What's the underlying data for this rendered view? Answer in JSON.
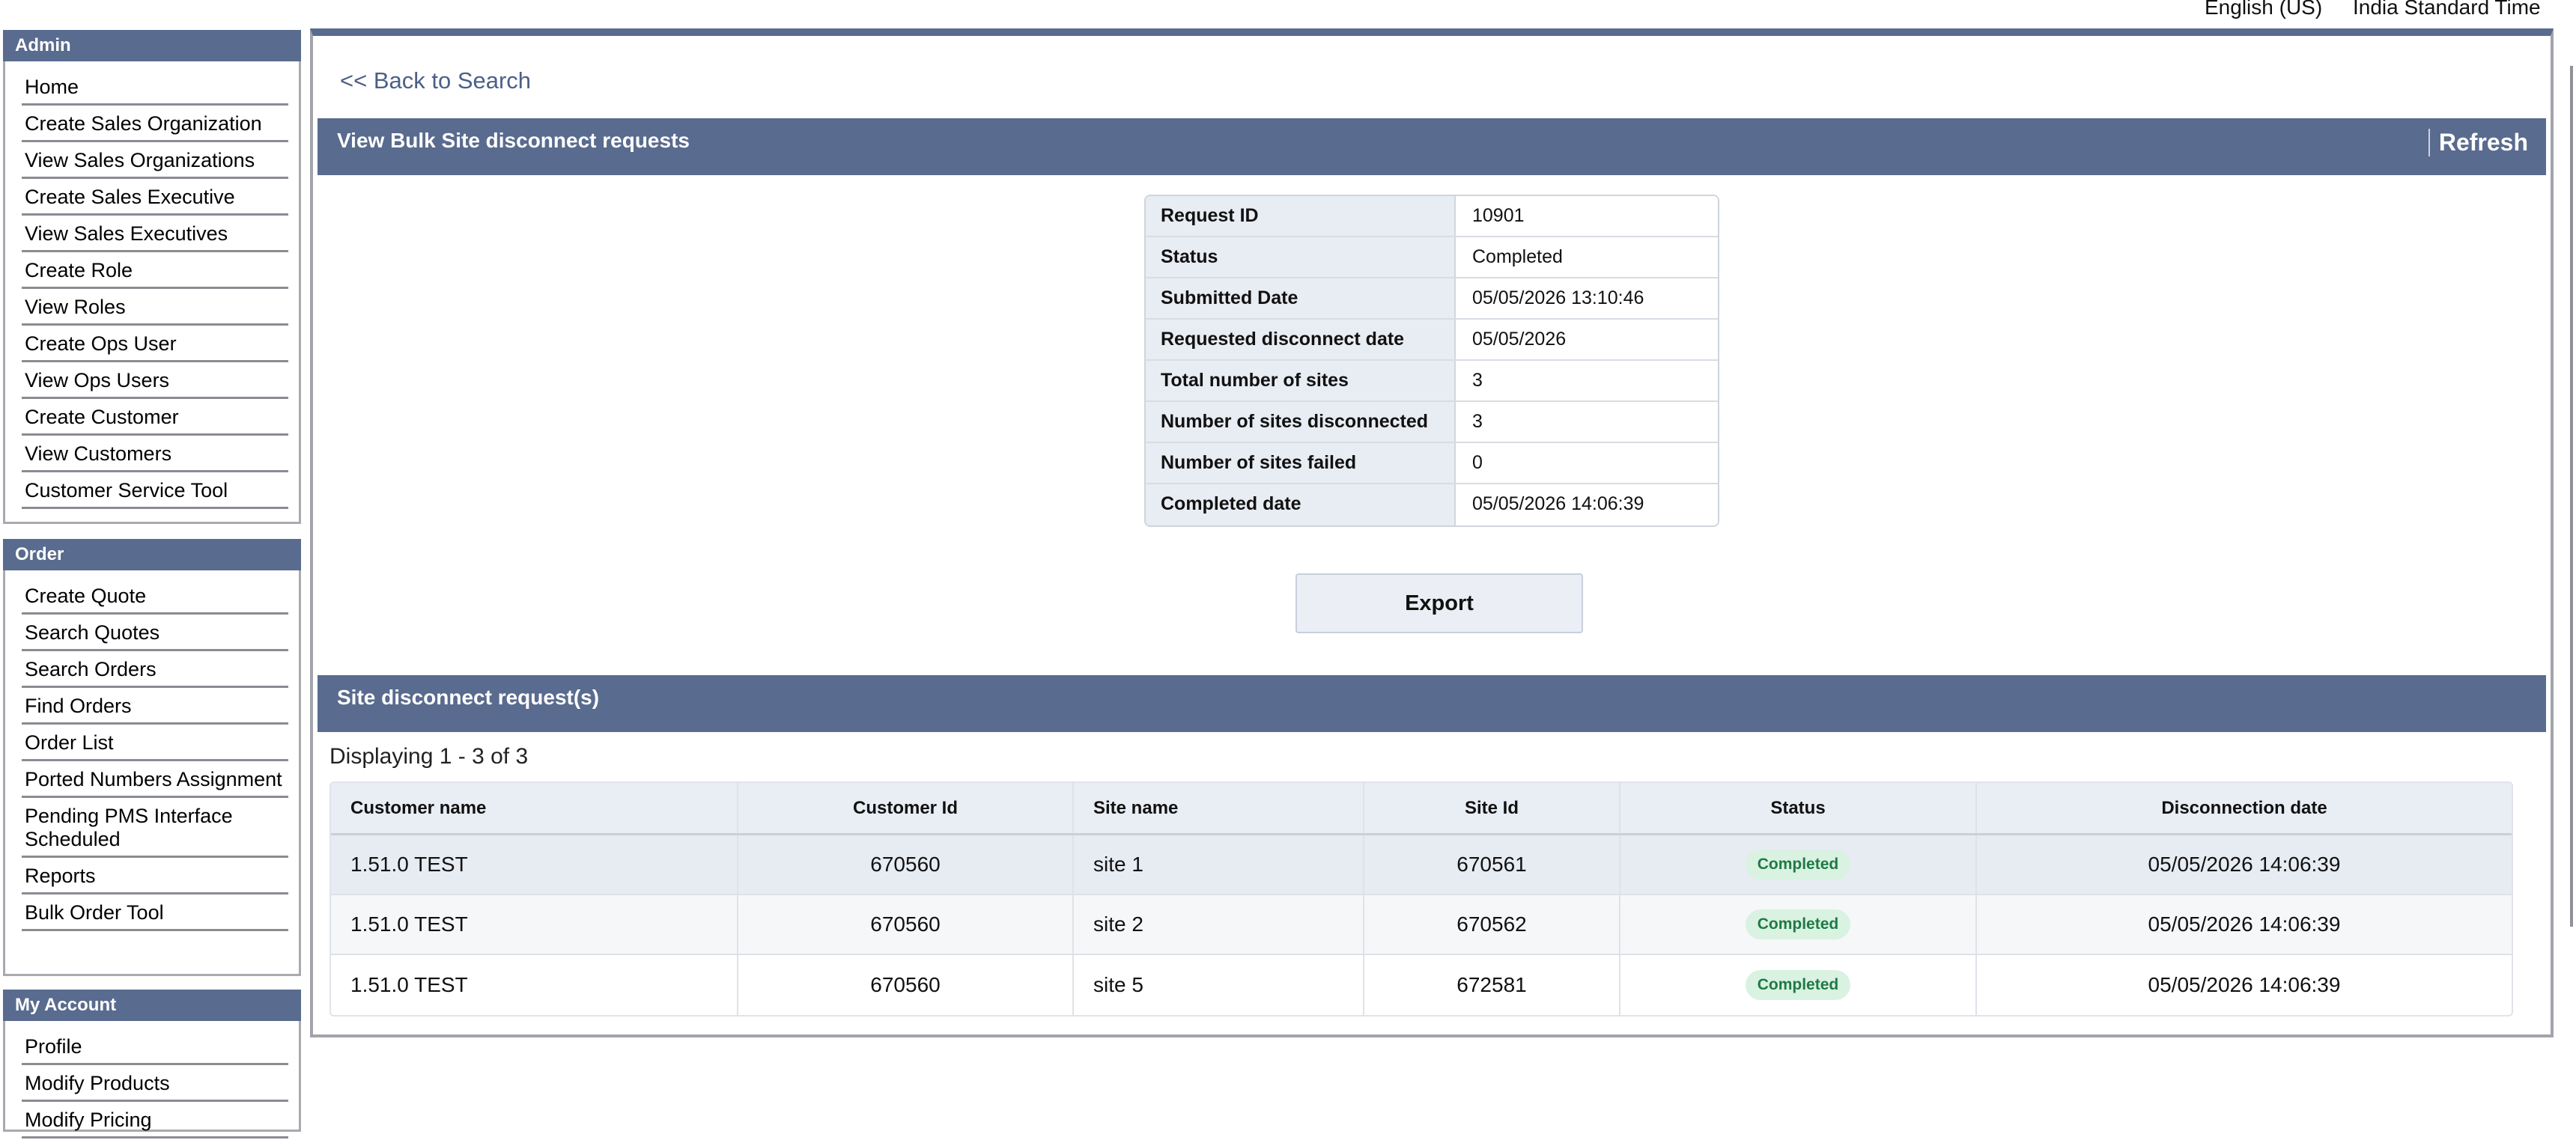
{
  "topbar": {
    "language": "English (US)",
    "timezone": "India Standard Time"
  },
  "sidebar": {
    "admin": {
      "title": "Admin",
      "items": [
        "Home",
        "Create Sales Organization",
        "View Sales Organizations",
        "Create Sales Executive",
        "View Sales Executives",
        "Create Role",
        "View Roles",
        "Create Ops User",
        "View Ops Users",
        "Create Customer",
        "View Customers",
        "Customer Service Tool"
      ]
    },
    "order": {
      "title": "Order",
      "items": [
        "Create Quote",
        "Search Quotes",
        "Search Orders",
        "Find Orders",
        "Order List",
        "Ported Numbers Assignment",
        "Pending PMS Interface Scheduled",
        "Reports",
        "Bulk Order Tool"
      ]
    },
    "account": {
      "title": "My Account",
      "items": [
        "Profile",
        "Modify Products",
        "Modify Pricing"
      ]
    }
  },
  "main": {
    "back_link": "<< Back to Search",
    "header_title": "View Bulk Site disconnect requests",
    "refresh_label": "Refresh",
    "details": [
      {
        "label": "Request ID",
        "value": "10901"
      },
      {
        "label": "Status",
        "value": "Completed"
      },
      {
        "label": "Submitted Date",
        "value": "05/05/2026 13:10:46"
      },
      {
        "label": "Requested disconnect date",
        "value": "05/05/2026"
      },
      {
        "label": "Total number of sites",
        "value": "3"
      },
      {
        "label": "Number of sites disconnected",
        "value": "3"
      },
      {
        "label": "Number of sites failed",
        "value": "0"
      },
      {
        "label": "Completed date",
        "value": "05/05/2026 14:06:39"
      }
    ],
    "export_label": "Export",
    "sites_title": "Site disconnect request(s)",
    "displaying": "Displaying 1 - 3 of 3",
    "table": {
      "headers": [
        "Customer name",
        "Customer Id",
        "Site name",
        "Site Id",
        "Status",
        "Disconnection date"
      ],
      "rows": [
        [
          "1.51.0 TEST",
          "670560",
          "site 1",
          "670561",
          "Completed",
          "05/05/2026 14:06:39"
        ],
        [
          "1.51.0 TEST",
          "670560",
          "site 2",
          "670562",
          "Completed",
          "05/05/2026 14:06:39"
        ],
        [
          "1.51.0 TEST",
          "670560",
          "site 5",
          "672581",
          "Completed",
          "05/05/2026 14:06:39"
        ]
      ]
    }
  },
  "colors": {
    "header_blue": "#596b8e",
    "link_blue": "#4b5f88",
    "badge_green": "#1f7a45",
    "badge_bg": "#d9f2e2"
  }
}
